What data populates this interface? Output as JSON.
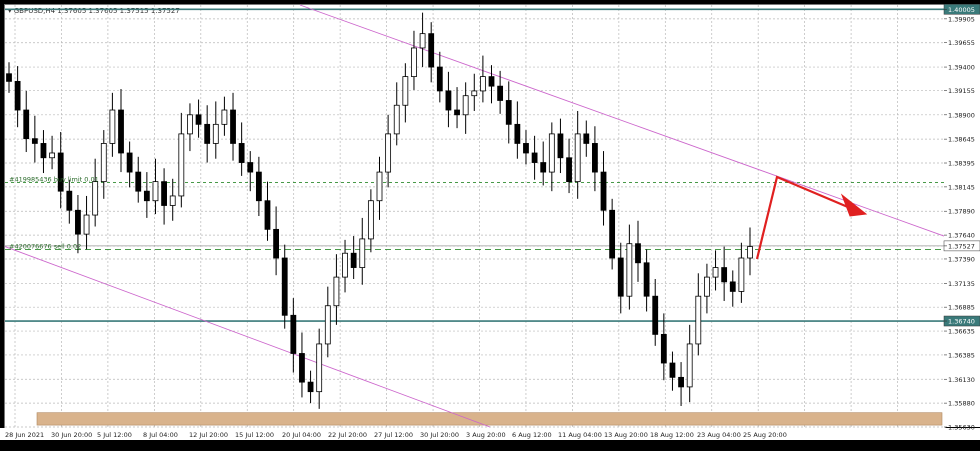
{
  "chart_data": {
    "type": "candlestick",
    "symbol_header": "GBPUSD,H4  1.37605 1.37605 1.37515 1.37527",
    "y_ticks": [
      "1.40005",
      "1.39905",
      "1.39655",
      "1.39400",
      "1.39155",
      "1.38900",
      "1.38645",
      "1.38395",
      "1.38145",
      "1.37890",
      "1.37640",
      "1.37527",
      "1.37390",
      "1.37135",
      "1.36885",
      "1.36740",
      "1.36635",
      "1.36385",
      "1.36130",
      "1.35880",
      "1.35630"
    ],
    "y_tick_values": [
      1.40005,
      1.39905,
      1.39655,
      1.394,
      1.39155,
      1.389,
      1.38645,
      1.38395,
      1.38145,
      1.3789,
      1.3764,
      1.37527,
      1.3739,
      1.37135,
      1.36885,
      1.3674,
      1.36635,
      1.36385,
      1.3613,
      1.3588,
      1.3563
    ],
    "x_ticks": [
      "28 Jun 2021",
      "30 Jun 20:00",
      "5 Jul 12:00",
      "8 Jul 04:00",
      "12 Jul 20:00",
      "15 Jul 12:00",
      "20 Jul 04:00",
      "22 Jul 20:00",
      "27 Jul 12:00",
      "30 Jul 20:00",
      "3 Aug 20:00",
      "6 Aug 12:00",
      "11 Aug 04:00",
      "13 Aug 20:00",
      "18 Aug 12:00",
      "23 Aug 04:00",
      "25 Aug 20:00"
    ],
    "ylim": [
      1.3563,
      1.4005
    ],
    "price_levels": [
      {
        "label": "1.40005",
        "value": 1.40005,
        "style": "solid",
        "color": "#3a7a7a"
      },
      {
        "label": "1.36740",
        "value": 1.3674,
        "style": "solid",
        "color": "#3a7a7a"
      },
      {
        "label": "1.37527",
        "value": 1.37527,
        "style": "ask",
        "color": "#999999"
      }
    ],
    "order_lines": [
      {
        "label": "#419985436 buy limit 0.01",
        "value": 1.3819,
        "color": "#2e8b2e"
      },
      {
        "label": "#420076676 sell 0.02",
        "value": 1.3749,
        "color": "#2e8b2e"
      }
    ],
    "support_zone": {
      "from": 1.3565,
      "to": 1.3578,
      "color": "#d9b38c"
    },
    "channel_color": "#cc66cc",
    "arrow_color": "#e02020",
    "candles_path_closes": [
      1.3925,
      1.3895,
      1.3865,
      1.386,
      1.3845,
      1.385,
      1.381,
      1.379,
      1.3765,
      1.3785,
      1.382,
      1.386,
      1.3895,
      1.385,
      1.383,
      1.381,
      1.38,
      1.382,
      1.3795,
      1.3805,
      1.387,
      1.389,
      1.388,
      1.386,
      1.388,
      1.3895,
      1.386,
      1.384,
      1.383,
      1.38,
      1.377,
      1.374,
      1.368,
      1.364,
      1.361,
      1.36,
      1.365,
      1.369,
      1.372,
      1.3745,
      1.373,
      1.376,
      1.38,
      1.383,
      1.387,
      1.39,
      1.393,
      1.396,
      1.3975,
      1.394,
      1.3915,
      1.3895,
      1.389,
      1.391,
      1.3915,
      1.393,
      1.392,
      1.3905,
      1.388,
      1.386,
      1.385,
      1.384,
      1.383,
      1.387,
      1.3845,
      1.382,
      1.387,
      1.386,
      1.383,
      1.379,
      1.374,
      1.37,
      1.3755,
      1.3735,
      1.37,
      1.366,
      1.363,
      1.3615,
      1.3605,
      1.365,
      1.37,
      1.372,
      1.373,
      1.3715,
      1.3705,
      1.374,
      1.3752
    ]
  }
}
